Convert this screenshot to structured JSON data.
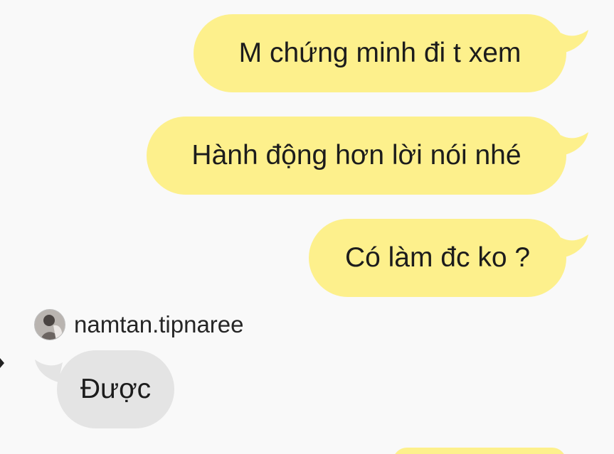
{
  "colors": {
    "outgoing_bubble": "#fdf08c",
    "incoming_bubble": "#e4e4e4",
    "background": "#f9f9f9",
    "text": "#1c1c1c"
  },
  "messages": [
    {
      "direction": "outgoing",
      "text": "M chứng minh đi t xem"
    },
    {
      "direction": "outgoing",
      "text": "Hành động hơn lời nói nhé"
    },
    {
      "direction": "outgoing",
      "text": "Có làm đc ko ?"
    },
    {
      "direction": "incoming",
      "sender": "namtan.tipnaree",
      "text": "Được"
    }
  ],
  "icons": {
    "edge_arrow": "chevron-right-icon",
    "avatar": "user-avatar"
  }
}
